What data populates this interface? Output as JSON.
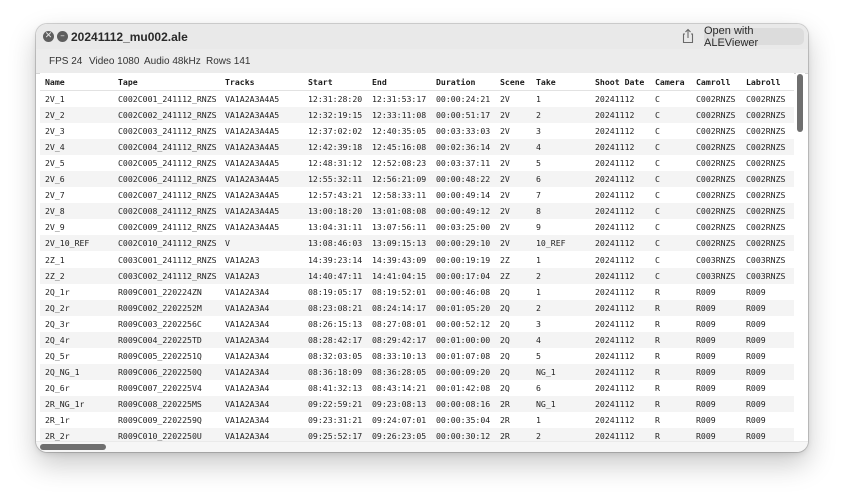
{
  "window": {
    "title": "20241112_mu002.ale",
    "open_button_label": "Open with ALEViewer",
    "icons": {
      "close": "close-icon",
      "minimize": "minus-icon",
      "share": "share-icon"
    }
  },
  "toolbar": {
    "fps": "FPS 24",
    "video": "Video 1080",
    "audio": "Audio 48kHz",
    "rows": "Rows 141"
  },
  "table": {
    "columns": [
      "Name",
      "Tape",
      "Tracks",
      "Start",
      "End",
      "Duration",
      "Scene",
      "Take",
      "Shoot Date",
      "Camera",
      "Camroll",
      "Labroll"
    ],
    "rows": [
      [
        "2V_1",
        "C002C001_241112_RNZS",
        "VA1A2A3A4A5",
        "12:31:28:20",
        "12:31:53:17",
        "00:00:24:21",
        "2V",
        "1",
        "20241112",
        "C",
        "C002RNZS",
        "C002RNZS"
      ],
      [
        "2V_2",
        "C002C002_241112_RNZS",
        "VA1A2A3A4A5",
        "12:32:19:15",
        "12:33:11:08",
        "00:00:51:17",
        "2V",
        "2",
        "20241112",
        "C",
        "C002RNZS",
        "C002RNZS"
      ],
      [
        "2V_3",
        "C002C003_241112_RNZS",
        "VA1A2A3A4A5",
        "12:37:02:02",
        "12:40:35:05",
        "00:03:33:03",
        "2V",
        "3",
        "20241112",
        "C",
        "C002RNZS",
        "C002RNZS"
      ],
      [
        "2V_4",
        "C002C004_241112_RNZS",
        "VA1A2A3A4A5",
        "12:42:39:18",
        "12:45:16:08",
        "00:02:36:14",
        "2V",
        "4",
        "20241112",
        "C",
        "C002RNZS",
        "C002RNZS"
      ],
      [
        "2V_5",
        "C002C005_241112_RNZS",
        "VA1A2A3A4A5",
        "12:48:31:12",
        "12:52:08:23",
        "00:03:37:11",
        "2V",
        "5",
        "20241112",
        "C",
        "C002RNZS",
        "C002RNZS"
      ],
      [
        "2V_6",
        "C002C006_241112_RNZS",
        "VA1A2A3A4A5",
        "12:55:32:11",
        "12:56:21:09",
        "00:00:48:22",
        "2V",
        "6",
        "20241112",
        "C",
        "C002RNZS",
        "C002RNZS"
      ],
      [
        "2V_7",
        "C002C007_241112_RNZS",
        "VA1A2A3A4A5",
        "12:57:43:21",
        "12:58:33:11",
        "00:00:49:14",
        "2V",
        "7",
        "20241112",
        "C",
        "C002RNZS",
        "C002RNZS"
      ],
      [
        "2V_8",
        "C002C008_241112_RNZS",
        "VA1A2A3A4A5",
        "13:00:18:20",
        "13:01:08:08",
        "00:00:49:12",
        "2V",
        "8",
        "20241112",
        "C",
        "C002RNZS",
        "C002RNZS"
      ],
      [
        "2V_9",
        "C002C009_241112_RNZS",
        "VA1A2A3A4A5",
        "13:04:31:11",
        "13:07:56:11",
        "00:03:25:00",
        "2V",
        "9",
        "20241112",
        "C",
        "C002RNZS",
        "C002RNZS"
      ],
      [
        "2V_10_REF",
        "C002C010_241112_RNZS",
        "V",
        "13:08:46:03",
        "13:09:15:13",
        "00:00:29:10",
        "2V",
        "10_REF",
        "20241112",
        "C",
        "C002RNZS",
        "C002RNZS"
      ],
      [
        "2Z_1",
        "C003C001_241112_RNZS",
        "VA1A2A3",
        "14:39:23:14",
        "14:39:43:09",
        "00:00:19:19",
        "2Z",
        "1",
        "20241112",
        "C",
        "C003RNZS",
        "C003RNZS"
      ],
      [
        "2Z_2",
        "C003C002_241112_RNZS",
        "VA1A2A3",
        "14:40:47:11",
        "14:41:04:15",
        "00:00:17:04",
        "2Z",
        "2",
        "20241112",
        "C",
        "C003RNZS",
        "C003RNZS"
      ],
      [
        "2Q_1r",
        "R009C001_220224ZN",
        "VA1A2A3A4",
        "08:19:05:17",
        "08:19:52:01",
        "00:00:46:08",
        "2Q",
        "1",
        "20241112",
        "R",
        "R009",
        "R009"
      ],
      [
        "2Q_2r",
        "R009C002_2202252M",
        "VA1A2A3A4",
        "08:23:08:21",
        "08:24:14:17",
        "00:01:05:20",
        "2Q",
        "2",
        "20241112",
        "R",
        "R009",
        "R009"
      ],
      [
        "2Q_3r",
        "R009C003_2202256C",
        "VA1A2A3A4",
        "08:26:15:13",
        "08:27:08:01",
        "00:00:52:12",
        "2Q",
        "3",
        "20241112",
        "R",
        "R009",
        "R009"
      ],
      [
        "2Q_4r",
        "R009C004_220225TD",
        "VA1A2A3A4",
        "08:28:42:17",
        "08:29:42:17",
        "00:01:00:00",
        "2Q",
        "4",
        "20241112",
        "R",
        "R009",
        "R009"
      ],
      [
        "2Q_5r",
        "R009C005_2202251Q",
        "VA1A2A3A4",
        "08:32:03:05",
        "08:33:10:13",
        "00:01:07:08",
        "2Q",
        "5",
        "20241112",
        "R",
        "R009",
        "R009"
      ],
      [
        "2Q_NG_1",
        "R009C006_2202250Q",
        "VA1A2A3A4",
        "08:36:18:09",
        "08:36:28:05",
        "00:00:09:20",
        "2Q",
        "NG_1",
        "20241112",
        "R",
        "R009",
        "R009"
      ],
      [
        "2Q_6r",
        "R009C007_220225V4",
        "VA1A2A3A4",
        "08:41:32:13",
        "08:43:14:21",
        "00:01:42:08",
        "2Q",
        "6",
        "20241112",
        "R",
        "R009",
        "R009"
      ],
      [
        "2R_NG_1r",
        "R009C008_220225MS",
        "VA1A2A3A4",
        "09:22:59:21",
        "09:23:08:13",
        "00:00:08:16",
        "2R",
        "NG_1",
        "20241112",
        "R",
        "R009",
        "R009"
      ],
      [
        "2R_1r",
        "R009C009_2202259Q",
        "VA1A2A3A4",
        "09:23:31:21",
        "09:24:07:01",
        "00:00:35:04",
        "2R",
        "1",
        "20241112",
        "R",
        "R009",
        "R009"
      ],
      [
        "2R_2r",
        "R009C010_2202250U",
        "VA1A2A3A4",
        "09:25:52:17",
        "09:26:23:05",
        "00:00:30:12",
        "2R",
        "2",
        "20241112",
        "R",
        "R009",
        "R009"
      ]
    ]
  }
}
